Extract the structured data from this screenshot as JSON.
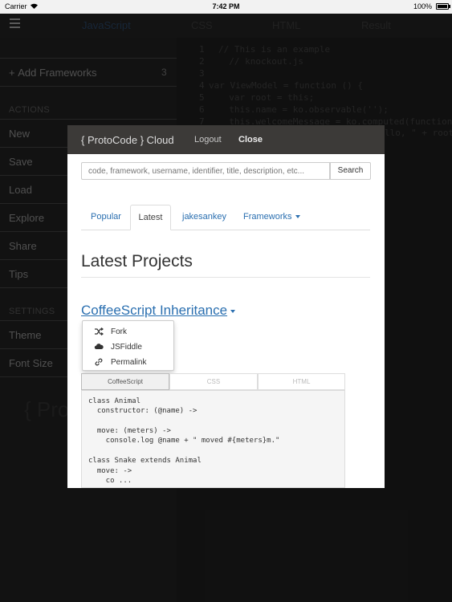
{
  "status_bar": {
    "carrier": "Carrier",
    "time": "7:42 PM",
    "battery": "100%"
  },
  "editor_tabs": [
    "JavaScript",
    "CSS",
    "HTML",
    "Result"
  ],
  "sidebar": {
    "add_frameworks_label": "Add Frameworks",
    "add_frameworks_count": "3",
    "actions_heading": "ACTIONS",
    "actions": [
      "New",
      "Save",
      "Load",
      "Explore",
      "Share",
      "Tips"
    ],
    "settings_heading": "SETTINGS",
    "settings": [
      "Theme",
      "Font Size"
    ],
    "ghost_logo": "{ Pro"
  },
  "editor": {
    "line_numbers": [
      "1",
      "2",
      "3",
      "4",
      "5",
      "6",
      "7"
    ],
    "lines": [
      "// This is an example",
      "  // knockout.js",
      "",
      "var ViewModel = function () {",
      "  var root = this;",
      "  this.name = ko.observable('');",
      "  this.welcomeMessage = ko.computed(function() {"
    ],
    "line8_tail": "llo, \" + root.na"
  },
  "modal": {
    "brand": "{ ProtoCode } Cloud",
    "logout": "Logout",
    "close": "Close",
    "search_placeholder": "code, framework, username, identifier, title, description, etc...",
    "search_button": "Search",
    "tabs": {
      "popular": "Popular",
      "latest": "Latest",
      "user": "jakesankey",
      "frameworks": "Frameworks"
    },
    "heading": "Latest Projects",
    "project_title": "CoffeeScript Inheritance",
    "dropdown": [
      "Fork",
      "JSFiddle",
      "Permalink"
    ],
    "code_tabs": [
      "CoffeeScript",
      "CSS",
      "HTML"
    ],
    "code_lines": [
      "class Animal",
      "  constructor: (@name) ->",
      "",
      "  move: (meters) ->",
      "    console.log @name + \" moved #{meters}m.\"",
      "",
      "class Snake extends Animal",
      "  move: ->",
      "    co ..."
    ]
  }
}
